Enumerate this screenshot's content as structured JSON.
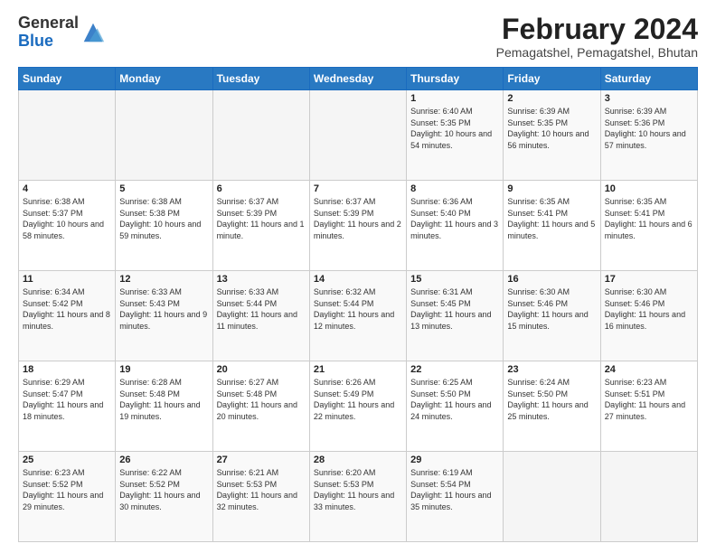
{
  "header": {
    "logo_line1": "General",
    "logo_line2": "Blue",
    "title": "February 2024",
    "subtitle": "Pemagatshel, Pemagatshel, Bhutan"
  },
  "weekdays": [
    "Sunday",
    "Monday",
    "Tuesday",
    "Wednesday",
    "Thursday",
    "Friday",
    "Saturday"
  ],
  "weeks": [
    [
      {
        "day": "",
        "info": ""
      },
      {
        "day": "",
        "info": ""
      },
      {
        "day": "",
        "info": ""
      },
      {
        "day": "",
        "info": ""
      },
      {
        "day": "1",
        "info": "Sunrise: 6:40 AM\nSunset: 5:35 PM\nDaylight: 10 hours and 54 minutes."
      },
      {
        "day": "2",
        "info": "Sunrise: 6:39 AM\nSunset: 5:35 PM\nDaylight: 10 hours and 56 minutes."
      },
      {
        "day": "3",
        "info": "Sunrise: 6:39 AM\nSunset: 5:36 PM\nDaylight: 10 hours and 57 minutes."
      }
    ],
    [
      {
        "day": "4",
        "info": "Sunrise: 6:38 AM\nSunset: 5:37 PM\nDaylight: 10 hours and 58 minutes."
      },
      {
        "day": "5",
        "info": "Sunrise: 6:38 AM\nSunset: 5:38 PM\nDaylight: 10 hours and 59 minutes."
      },
      {
        "day": "6",
        "info": "Sunrise: 6:37 AM\nSunset: 5:39 PM\nDaylight: 11 hours and 1 minute."
      },
      {
        "day": "7",
        "info": "Sunrise: 6:37 AM\nSunset: 5:39 PM\nDaylight: 11 hours and 2 minutes."
      },
      {
        "day": "8",
        "info": "Sunrise: 6:36 AM\nSunset: 5:40 PM\nDaylight: 11 hours and 3 minutes."
      },
      {
        "day": "9",
        "info": "Sunrise: 6:35 AM\nSunset: 5:41 PM\nDaylight: 11 hours and 5 minutes."
      },
      {
        "day": "10",
        "info": "Sunrise: 6:35 AM\nSunset: 5:41 PM\nDaylight: 11 hours and 6 minutes."
      }
    ],
    [
      {
        "day": "11",
        "info": "Sunrise: 6:34 AM\nSunset: 5:42 PM\nDaylight: 11 hours and 8 minutes."
      },
      {
        "day": "12",
        "info": "Sunrise: 6:33 AM\nSunset: 5:43 PM\nDaylight: 11 hours and 9 minutes."
      },
      {
        "day": "13",
        "info": "Sunrise: 6:33 AM\nSunset: 5:44 PM\nDaylight: 11 hours and 11 minutes."
      },
      {
        "day": "14",
        "info": "Sunrise: 6:32 AM\nSunset: 5:44 PM\nDaylight: 11 hours and 12 minutes."
      },
      {
        "day": "15",
        "info": "Sunrise: 6:31 AM\nSunset: 5:45 PM\nDaylight: 11 hours and 13 minutes."
      },
      {
        "day": "16",
        "info": "Sunrise: 6:30 AM\nSunset: 5:46 PM\nDaylight: 11 hours and 15 minutes."
      },
      {
        "day": "17",
        "info": "Sunrise: 6:30 AM\nSunset: 5:46 PM\nDaylight: 11 hours and 16 minutes."
      }
    ],
    [
      {
        "day": "18",
        "info": "Sunrise: 6:29 AM\nSunset: 5:47 PM\nDaylight: 11 hours and 18 minutes."
      },
      {
        "day": "19",
        "info": "Sunrise: 6:28 AM\nSunset: 5:48 PM\nDaylight: 11 hours and 19 minutes."
      },
      {
        "day": "20",
        "info": "Sunrise: 6:27 AM\nSunset: 5:48 PM\nDaylight: 11 hours and 20 minutes."
      },
      {
        "day": "21",
        "info": "Sunrise: 6:26 AM\nSunset: 5:49 PM\nDaylight: 11 hours and 22 minutes."
      },
      {
        "day": "22",
        "info": "Sunrise: 6:25 AM\nSunset: 5:50 PM\nDaylight: 11 hours and 24 minutes."
      },
      {
        "day": "23",
        "info": "Sunrise: 6:24 AM\nSunset: 5:50 PM\nDaylight: 11 hours and 25 minutes."
      },
      {
        "day": "24",
        "info": "Sunrise: 6:23 AM\nSunset: 5:51 PM\nDaylight: 11 hours and 27 minutes."
      }
    ],
    [
      {
        "day": "25",
        "info": "Sunrise: 6:23 AM\nSunset: 5:52 PM\nDaylight: 11 hours and 29 minutes."
      },
      {
        "day": "26",
        "info": "Sunrise: 6:22 AM\nSunset: 5:52 PM\nDaylight: 11 hours and 30 minutes."
      },
      {
        "day": "27",
        "info": "Sunrise: 6:21 AM\nSunset: 5:53 PM\nDaylight: 11 hours and 32 minutes."
      },
      {
        "day": "28",
        "info": "Sunrise: 6:20 AM\nSunset: 5:53 PM\nDaylight: 11 hours and 33 minutes."
      },
      {
        "day": "29",
        "info": "Sunrise: 6:19 AM\nSunset: 5:54 PM\nDaylight: 11 hours and 35 minutes."
      },
      {
        "day": "",
        "info": ""
      },
      {
        "day": "",
        "info": ""
      }
    ]
  ]
}
